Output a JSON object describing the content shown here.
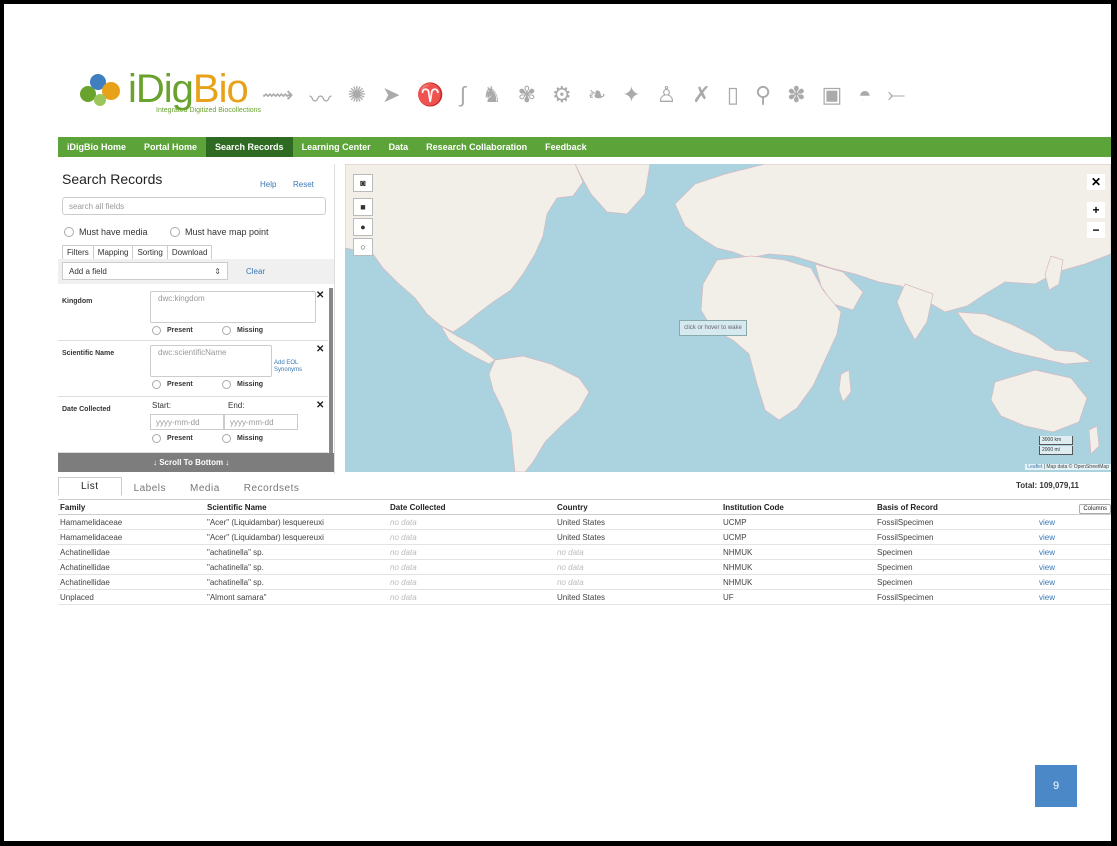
{
  "logo": {
    "title_main": "iDig",
    "title_accent": "Bio",
    "subtitle": "Integrated Digitized Biocollections"
  },
  "nav": {
    "items": [
      {
        "label": "iDigBio Home"
      },
      {
        "label": "Portal Home"
      },
      {
        "label": "Search Records",
        "active": true
      },
      {
        "label": "Learning Center"
      },
      {
        "label": "Data"
      },
      {
        "label": "Research Collaboration"
      },
      {
        "label": "Feedback"
      }
    ],
    "color": "#5ca43a",
    "active_color": "#2f6a22"
  },
  "search_panel": {
    "title": "Search Records",
    "help": "Help",
    "reset": "Reset",
    "search_placeholder": "search all fields",
    "must_have_media": "Must have media",
    "must_have_map_point": "Must have map point",
    "tabs": [
      "Filters",
      "Mapping",
      "Sorting",
      "Download"
    ],
    "add_field": "Add a field",
    "clear": "Clear",
    "filters": {
      "kingdom": {
        "label": "Kingdom",
        "placeholder": "dwc:kingdom",
        "present": "Present",
        "missing": "Missing"
      },
      "scientific_name": {
        "label": "Scientific Name",
        "placeholder": "dwc:scientificName",
        "eol": "Add EOL Synonyms",
        "present": "Present",
        "missing": "Missing"
      },
      "date_collected": {
        "label": "Date Collected",
        "start": "Start:",
        "end": "End:",
        "start_placeholder": "yyyy-mm-dd",
        "end_placeholder": "yyyy-mm-dd",
        "present": "Present",
        "missing": "Missing"
      }
    },
    "scroll_to_bottom": "↓ Scroll To Bottom ↓"
  },
  "map": {
    "hint": "click or hover to wake",
    "scale_km": "3000 km",
    "scale_mi": "2000 mi",
    "attribution_link": "Leaflet",
    "attribution_text": " | Map data © OpenStreetMap",
    "ocean_color": "#aad3df",
    "land_color": "#f2efe9"
  },
  "results": {
    "tabs": [
      "List",
      "Labels",
      "Media",
      "Recordsets"
    ],
    "total": "Total: 109,079,11",
    "columns": [
      "Family",
      "Scientific Name",
      "Date Collected",
      "Country",
      "Institution Code",
      "Basis of Record",
      "Columns"
    ],
    "rows": [
      {
        "family": "Hamamelidaceae",
        "scientific_name": "\"Acer\" (Liquidambar) lesquereuxi",
        "date": "no data",
        "country": "United States",
        "inst": "UCMP",
        "basis": "FossilSpecimen",
        "link": "view"
      },
      {
        "family": "Hamamelidaceae",
        "scientific_name": "\"Acer\" (Liquidambar) lesquereuxi",
        "date": "no data",
        "country": "United States",
        "inst": "UCMP",
        "basis": "FossilSpecimen",
        "link": "view"
      },
      {
        "family": "Achatinellidae",
        "scientific_name": "\"achatinella\" sp.",
        "date": "no data",
        "country": "no data",
        "inst": "NHMUK",
        "basis": "Specimen",
        "link": "view"
      },
      {
        "family": "Achatinellidae",
        "scientific_name": "\"achatinella\" sp.",
        "date": "no data",
        "country": "no data",
        "inst": "NHMUK",
        "basis": "Specimen",
        "link": "view"
      },
      {
        "family": "Achatinellidae",
        "scientific_name": "\"achatinella\" sp.",
        "date": "no data",
        "country": "no data",
        "inst": "NHMUK",
        "basis": "Specimen",
        "link": "view"
      },
      {
        "family": "Unplaced",
        "scientific_name": "\"Almont samara\"",
        "date": "no data",
        "country": "United States",
        "inst": "UF",
        "basis": "FossilSpecimen",
        "link": "view"
      }
    ]
  },
  "page_number": "9"
}
